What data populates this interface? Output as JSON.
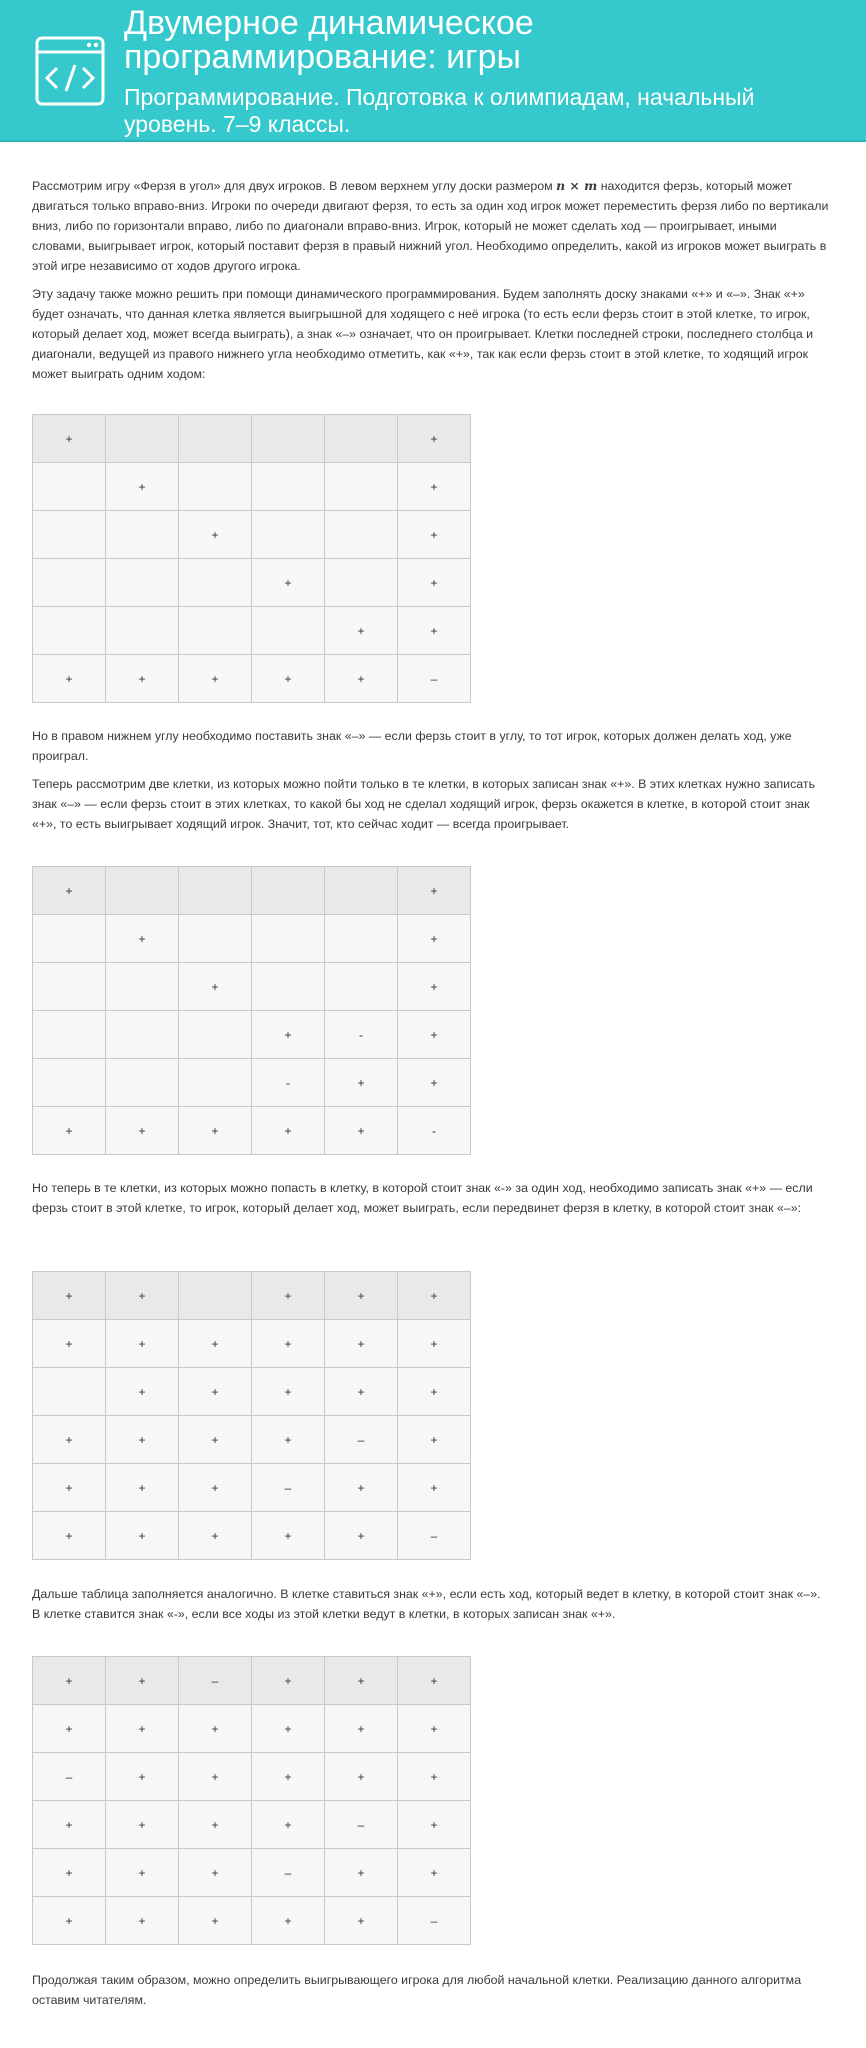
{
  "header": {
    "title": "Двумерное динамическое программирование: игры",
    "subtitle": "Программирование. Подготовка к олимпиадам, начальный уровень. 7–9 классы."
  },
  "intro": {
    "p1_part1": "Рассмотрим игру «Ферзя в угол» для двух игроков. В левом верхнем углу доски размером ",
    "p1_math": "n × m",
    "p1_part2": " находится ферзь, который может двигаться только вправо-вниз. Игроки по очереди двигают ферзя, то есть за один ход игрок может переместить ферзя либо по вертикали вниз, либо по горизонтали вправо, либо по диагонали вправо-вниз. Игрок, который не может сделать ход — проигрывает, иными словами, выигрывает игрок, который поставит ферзя в правый нижний угол. Необходимо определить, какой из игроков может выиграть в этой игре независимо от ходов другого игрока.",
    "p2": "Эту задачу также можно решить при помощи динамического программирования. Будем заполнять доску знаками «+» и «–». Знак «+» будет означать, что данная клетка является выигрышной для ходящего с неё игрока (то есть если ферзь стоит в этой клетке, то игрок, который делает ход, может всегда выиграть), а знак «–» означает, что он проигрывает. Клетки последней строки, последнего столбца и диагонали, ведущей из правого нижнего угла необходимо отметить, как «+», так как если ферзь стоит в этой клетке, то ходящий игрок может выиграть одним ходом:"
  },
  "text_after_1": {
    "p1": "Но в правом нижнем углу необходимо поставить знак «–» — если ферзь стоит в углу, то тот игрок, которых должен делать ход, уже проиграл.",
    "p2": "Теперь рассмотрим две клетки, из которых можно пойти только в те клетки, в которых записан знак «+». В этих клетках нужно записать знак «–» — если ферзь стоит в этих клетках, то какой бы ход не сделал ходящий игрок, ферзь окажется в клетке, в которой стоит знак «+», то есть выигрывает ходящий игрок. Значит, тот, кто сейчас ходит — всегда проигрывает."
  },
  "text_after_2": {
    "p1": "Но теперь в те клетки, из которых можно попасть в клетку, в которой стоит знак «-» за один ход, необходимо записать знак «+» — если ферзь стоит в этой клетке, то игрок, который делает ход, может выиграть, если передвинет ферзя в клетку, в которой стоит знак «–»:"
  },
  "text_after_3": {
    "p1": "Дальше таблица заполняется аналогично. В клетке ставиться знак «+», если есть ход, который ведет в клетку, в  которой стоит знак «–». В клетке ставится знак «-», если все ходы из этой клетки ведут в клетки, в которых записан знак «+»."
  },
  "text_after_4": {
    "p1": "Продолжая таким образом, можно определить выигрывающего игрока для любой начальной клетки. Реализацию данного алгоритма оставим читателям."
  },
  "boards": [
    [
      [
        "+",
        "",
        "",
        "",
        "",
        "+"
      ],
      [
        "",
        "+",
        "",
        "",
        "",
        "+"
      ],
      [
        "",
        "",
        "+",
        "",
        "",
        "+"
      ],
      [
        "",
        "",
        "",
        "+",
        "",
        "+"
      ],
      [
        "",
        "",
        "",
        "",
        "+",
        "+"
      ],
      [
        "+",
        "+",
        "+",
        "+",
        "+",
        "–"
      ]
    ],
    [
      [
        "+",
        "",
        "",
        "",
        "",
        "+"
      ],
      [
        "",
        "+",
        "",
        "",
        "",
        "+"
      ],
      [
        "",
        "",
        "+",
        "",
        "",
        "+"
      ],
      [
        "",
        "",
        "",
        "+",
        "-",
        "+"
      ],
      [
        "",
        "",
        "",
        "-",
        "+",
        "+"
      ],
      [
        "+",
        "+",
        "+",
        "+",
        "+",
        "-"
      ]
    ],
    [
      [
        "+",
        "+",
        "",
        "+",
        "+",
        "+"
      ],
      [
        "+",
        "+",
        "+",
        "+",
        "+",
        "+"
      ],
      [
        "",
        "+",
        "+",
        "+",
        "+",
        "+"
      ],
      [
        "+",
        "+",
        "+",
        "+",
        "–",
        "+"
      ],
      [
        "+",
        "+",
        "+",
        "–",
        "+",
        "+"
      ],
      [
        "+",
        "+",
        "+",
        "+",
        "+",
        "–"
      ]
    ],
    [
      [
        "+",
        "+",
        "–",
        "+",
        "+",
        "+"
      ],
      [
        "+",
        "+",
        "+",
        "+",
        "+",
        "+"
      ],
      [
        "–",
        "+",
        "+",
        "+",
        "+",
        "+"
      ],
      [
        "+",
        "+",
        "+",
        "+",
        "–",
        "+"
      ],
      [
        "+",
        "+",
        "+",
        "–",
        "+",
        "+"
      ],
      [
        "+",
        "+",
        "+",
        "+",
        "+",
        "–"
      ]
    ]
  ]
}
